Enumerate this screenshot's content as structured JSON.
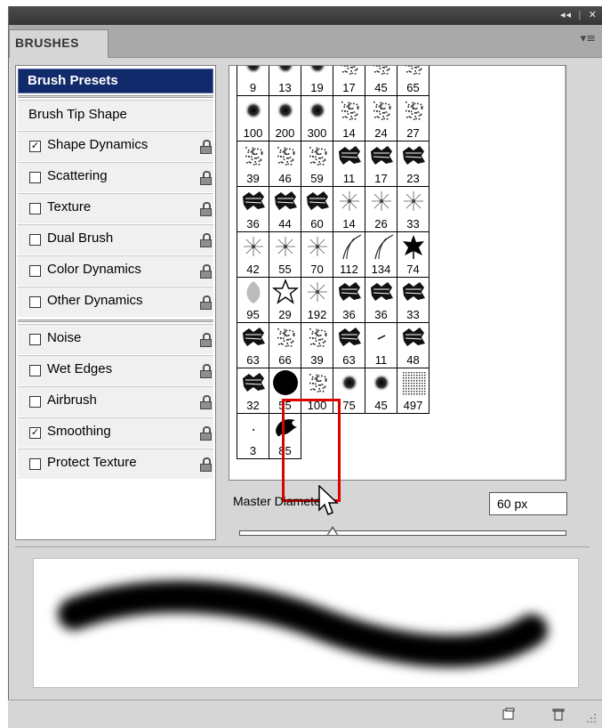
{
  "panel": {
    "tab_label": "BRUSHES",
    "collapse_glyph": "◂◂",
    "close_glyph": "✕",
    "menu_glyph": "▾≡"
  },
  "sidebar": {
    "header": "Brush Presets",
    "tip_shape": "Brush Tip Shape",
    "items": [
      {
        "label": "Shape Dynamics",
        "checked": true
      },
      {
        "label": "Scattering",
        "checked": false
      },
      {
        "label": "Texture",
        "checked": false
      },
      {
        "label": "Dual Brush",
        "checked": false
      },
      {
        "label": "Color Dynamics",
        "checked": false
      },
      {
        "label": "Other Dynamics",
        "checked": false
      },
      {
        "label": "Noise",
        "checked": false
      },
      {
        "label": "Wet Edges",
        "checked": false
      },
      {
        "label": "Airbrush",
        "checked": false
      },
      {
        "label": "Smoothing",
        "checked": true
      },
      {
        "label": "Protect Texture",
        "checked": false
      }
    ],
    "check_glyph": "✓"
  },
  "brush_grid": {
    "rows": [
      [
        {
          "size": "9",
          "kind": "soft"
        },
        {
          "size": "13",
          "kind": "soft"
        },
        {
          "size": "19",
          "kind": "soft"
        },
        {
          "size": "17",
          "kind": "spatter"
        },
        {
          "size": "45",
          "kind": "spatter"
        },
        {
          "size": "65",
          "kind": "spatter"
        }
      ],
      [
        {
          "size": "100",
          "kind": "soft"
        },
        {
          "size": "200",
          "kind": "soft"
        },
        {
          "size": "300",
          "kind": "soft"
        },
        {
          "size": "14",
          "kind": "spatter"
        },
        {
          "size": "24",
          "kind": "spatter"
        },
        {
          "size": "27",
          "kind": "spatter"
        }
      ],
      [
        {
          "size": "39",
          "kind": "spatter"
        },
        {
          "size": "46",
          "kind": "spatter"
        },
        {
          "size": "59",
          "kind": "spatter"
        },
        {
          "size": "11",
          "kind": "chalk"
        },
        {
          "size": "17",
          "kind": "chalk"
        },
        {
          "size": "23",
          "kind": "chalk"
        }
      ],
      [
        {
          "size": "36",
          "kind": "chalk"
        },
        {
          "size": "44",
          "kind": "chalk"
        },
        {
          "size": "60",
          "kind": "chalk"
        },
        {
          "size": "14",
          "kind": "star"
        },
        {
          "size": "26",
          "kind": "star"
        },
        {
          "size": "33",
          "kind": "star"
        }
      ],
      [
        {
          "size": "42",
          "kind": "star"
        },
        {
          "size": "55",
          "kind": "star"
        },
        {
          "size": "70",
          "kind": "star"
        },
        {
          "size": "112",
          "kind": "grass"
        },
        {
          "size": "134",
          "kind": "grass"
        },
        {
          "size": "74",
          "kind": "leaf"
        }
      ],
      [
        {
          "size": "95",
          "kind": "leafsoft"
        },
        {
          "size": "29",
          "kind": "staroutline"
        },
        {
          "size": "192",
          "kind": "star"
        },
        {
          "size": "36",
          "kind": "chalk"
        },
        {
          "size": "36",
          "kind": "chalk"
        },
        {
          "size": "33",
          "kind": "chalk"
        }
      ],
      [
        {
          "size": "63",
          "kind": "chalk"
        },
        {
          "size": "66",
          "kind": "spatter"
        },
        {
          "size": "39",
          "kind": "spatter"
        },
        {
          "size": "63",
          "kind": "chalk"
        },
        {
          "size": "11",
          "kind": "dash"
        },
        {
          "size": "48",
          "kind": "chalk"
        }
      ],
      [
        {
          "size": "32",
          "kind": "chalk"
        },
        {
          "size": "55",
          "kind": "hard"
        },
        {
          "size": "100",
          "kind": "spatter"
        },
        {
          "size": "75",
          "kind": "soft"
        },
        {
          "size": "45",
          "kind": "soft"
        },
        {
          "size": "497",
          "kind": "dots"
        }
      ],
      [
        {
          "size": "3",
          "kind": "dot"
        },
        {
          "size": "85",
          "kind": "blob"
        }
      ]
    ]
  },
  "scrollbar": {
    "up_glyph": "▲",
    "down_glyph": "▼"
  },
  "master_diameter": {
    "label": "Master Diameter",
    "value": "60 px"
  }
}
